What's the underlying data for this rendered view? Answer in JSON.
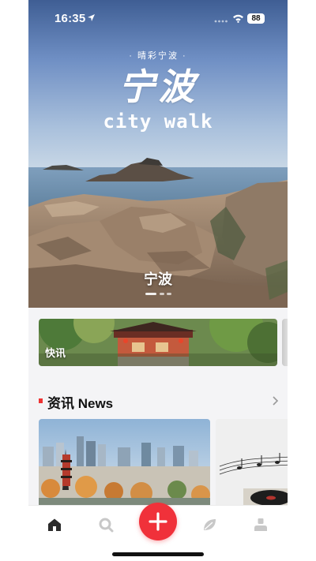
{
  "status_bar": {
    "time": "16:35",
    "battery": "88"
  },
  "hero": {
    "subtitle": "· 晴彩宁波 ·",
    "title": "宁波",
    "subtitle_en": "city walk",
    "caption": "宁波",
    "pages": 3,
    "active_page": 0
  },
  "quick_card": {
    "label": "快讯"
  },
  "news_section": {
    "title": "资讯 News"
  },
  "tabbar": {
    "items": [
      {
        "name": "home",
        "icon": "home-icon"
      },
      {
        "name": "search",
        "icon": "search-icon"
      },
      {
        "name": "add",
        "icon": "plus-icon"
      },
      {
        "name": "discover",
        "icon": "leaf-icon"
      },
      {
        "name": "profile",
        "icon": "person-icon"
      }
    ],
    "active": "home"
  },
  "colors": {
    "accent": "#f0313a",
    "section_marker": "#e33333",
    "tab_active": "#2b2b2b",
    "tab_inactive": "#c8c8c8"
  }
}
